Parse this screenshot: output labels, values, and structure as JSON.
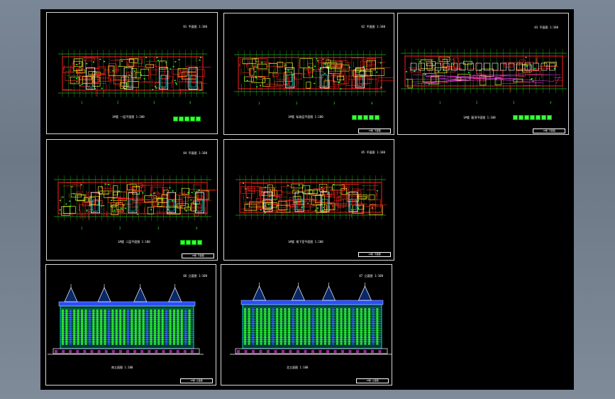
{
  "colors": {
    "background": "#000000",
    "frame": "#d8d8d8",
    "wall": "#ff2020",
    "grid": "#2eff2e",
    "yellow": "#ffff30",
    "cyan": "#00ffff",
    "blue": "#2a4dff",
    "magenta": "#ff40ff",
    "white": "#ffffff"
  },
  "sheets": [
    {
      "id": "plan-1",
      "tag": "01 平面图 1:100",
      "caption": "1#楼 一层平面图 1:100",
      "stamp": "",
      "axis": [
        "1",
        "2",
        "3",
        "4"
      ]
    },
    {
      "id": "plan-2",
      "tag": "02 平面图 1:100",
      "caption": "1#楼 标准层平面图 1:100",
      "stamp": "1#楼 平面图",
      "axis": [
        "1",
        "2",
        "3",
        "4"
      ]
    },
    {
      "id": "plan-3",
      "tag": "03 平面图 1:100",
      "caption": "1#楼 屋顶平面图 1:100",
      "stamp": "1#楼 平面图",
      "axis": [
        "1",
        "2",
        "3",
        "4"
      ]
    },
    {
      "id": "plan-4",
      "tag": "04 平面图 1:100",
      "caption": "1#楼 二层平面图 1:100",
      "stamp": "1#楼 平面图",
      "axis": [
        "1",
        "2",
        "3",
        "4"
      ]
    },
    {
      "id": "plan-5",
      "tag": "05 平面图 1:100",
      "caption": "1#楼 地下室平面图 1:100",
      "stamp": "1#楼 平面图",
      "axis": []
    },
    {
      "id": "elev-1",
      "tag": "06 立面图 1:100",
      "caption": "南立面图 1:100",
      "stamp": "1#楼 立面图"
    },
    {
      "id": "elev-2",
      "tag": "07 立面图 1:100",
      "caption": "北立面图 1:100",
      "stamp": "1#楼 立面图"
    }
  ]
}
